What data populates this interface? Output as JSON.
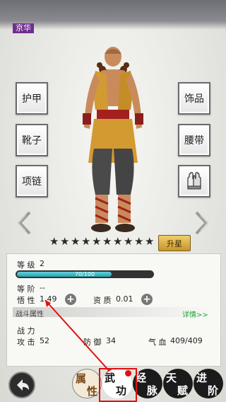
{
  "header": {
    "title": "京华"
  },
  "equipment": {
    "armor": "护甲",
    "boots": "靴子",
    "necklace": "项链",
    "accessory": "饰品",
    "belt": "腰带",
    "gloves_icon": "gloves-icon"
  },
  "stars": {
    "total": 10,
    "filled": 0
  },
  "upgrade_label": "升星",
  "stats": {
    "level_label": "等 级",
    "level_value": "2",
    "exp_text": "70/100",
    "exp_fraction": 0.7,
    "rank_label": "等 阶",
    "rank_value": "--",
    "comprehension_label": "悟 性",
    "comprehension_value": "1.49",
    "aptitude_label": "资 质",
    "aptitude_value": "0.01",
    "combat_attr_label": "战斗属性",
    "detail_link": "详情>>",
    "power_label": "战 力",
    "attack_label": "攻 击",
    "attack_value": "52",
    "defense_label": "防 御",
    "defense_value": "34",
    "hp_label": "气 血",
    "hp_value": "409/409"
  },
  "tabs": [
    {
      "label_top": "属",
      "label_bottom": "性"
    },
    {
      "label_top": "武",
      "label_bottom": "功"
    },
    {
      "label_top": "经",
      "label_bottom": "脉"
    },
    {
      "label_top": "天",
      "label_bottom": "赋"
    },
    {
      "label_top": "进",
      "label_bottom": "阶"
    }
  ],
  "colors": {
    "accent": "#e01010",
    "exp": "#25a3b0",
    "link": "#19a82b"
  }
}
